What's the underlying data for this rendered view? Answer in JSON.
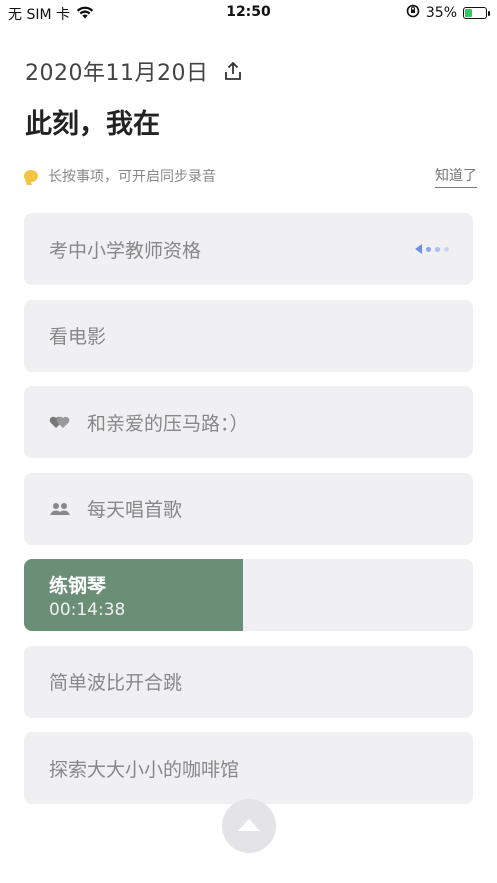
{
  "status_bar": {
    "carrier": "无 SIM 卡",
    "time": "12:50",
    "battery_percent": "35%",
    "battery_level": 0.35,
    "icons": [
      "wifi-icon",
      "orientation-lock-icon",
      "battery-icon"
    ]
  },
  "header": {
    "date": "2020年11月20日",
    "share_icon": "share-icon",
    "title": "此刻，我在"
  },
  "tip": {
    "text": "长按事项，可开启同步录音",
    "dismiss_label": "知道了",
    "icon": "chat-bubble-icon",
    "icon_color": "#f6c443"
  },
  "items": [
    {
      "label": "考中小学教师资格",
      "icon": null,
      "indicator": "dots-icon"
    },
    {
      "label": "看电影",
      "icon": null
    },
    {
      "label": "和亲爱的压马路：）",
      "icon": "hearts-icon"
    },
    {
      "label": "每天唱首歌",
      "icon": "group-icon"
    },
    {
      "label": "练钢琴",
      "time": "00:14:38",
      "active": true,
      "progress": 0.487,
      "accent": "#6b8f76"
    },
    {
      "label": "简单波比开合跳",
      "icon": null
    },
    {
      "label": "探索大大小小的咖啡馆",
      "icon": null
    }
  ],
  "fab": {
    "icon": "arrow-up-icon"
  }
}
